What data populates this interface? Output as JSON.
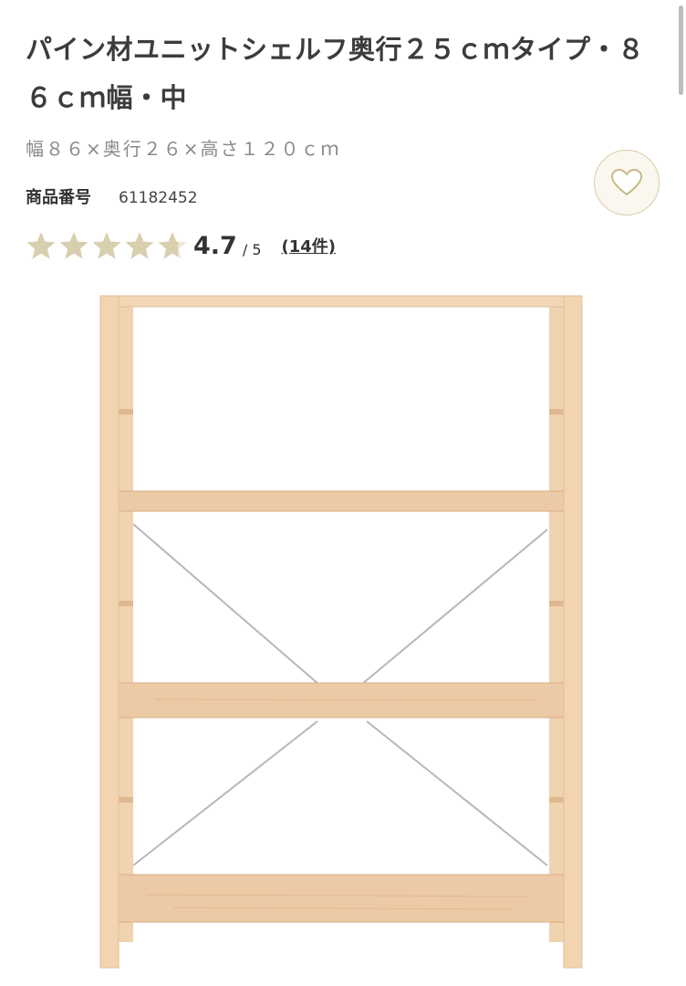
{
  "product": {
    "title": "パイン材ユニットシェルフ奥行２５ｃｍタイプ・８６ｃｍ幅・中",
    "size": "幅８６×奥行２６×高さ１２０ｃｍ",
    "number_label": "商品番号",
    "number_value": "61182452"
  },
  "rating": {
    "score": "4.7",
    "max": "/ 5",
    "stars": 4.7,
    "reviews_link": "(14件)"
  },
  "favorite": {
    "icon": "heart-icon"
  },
  "colors": {
    "star": "#d8cfae",
    "wood": "#ecc9a2",
    "heart_bg": "#faf7ee"
  },
  "image": {
    "subject": "pine-wood-shelf-image"
  }
}
